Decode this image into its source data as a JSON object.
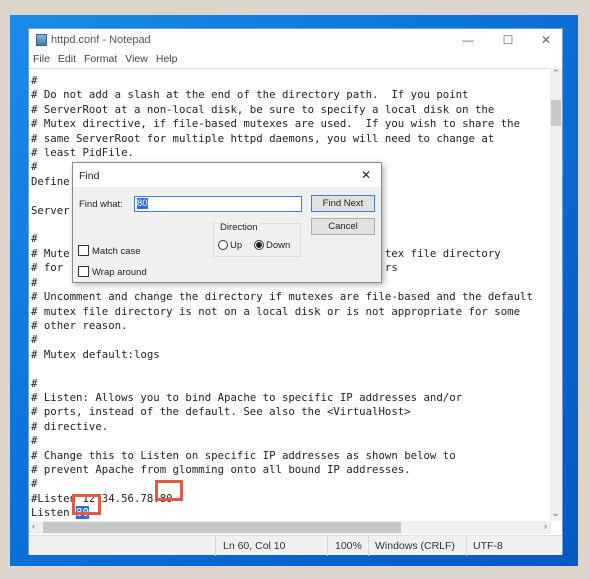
{
  "window": {
    "title": "httpd.conf - Notepad",
    "minimize": "—",
    "maximize": "☐",
    "close": "✕"
  },
  "menu": [
    "File",
    "Edit",
    "Format",
    "View",
    "Help"
  ],
  "editor": {
    "lines": [
      "#",
      "# Do not add a slash at the end of the directory path.  If you point",
      "# ServerRoot at a non-local disk, be sure to specify a local disk on the",
      "# Mutex directive, if file-based mutexes are used.  If you wish to share the",
      "# same ServerRoot for multiple httpd daemons, you will need to change at",
      "# least PidFile.",
      "#",
      "Define",
      "",
      "Server",
      "",
      "#",
      "# Mute                                                 tex file directory",
      "# for                                                  rs",
      "#",
      "# Uncomment and change the directory if mutexes are file-based and the default",
      "# mutex file directory is not on a local disk or is not appropriate for some",
      "# other reason.",
      "#",
      "# Mutex default:logs",
      "",
      "#",
      "# Listen: Allows you to bind Apache to specific IP addresses and/or",
      "# ports, instead of the default. See also the <VirtualHost>",
      "# directive.",
      "#",
      "# Change this to Listen on specific IP addresses as shown below to",
      "# prevent Apache from glomming onto all bound IP addresses.",
      "#",
      "#Listen 12.34.56.78:80"
    ],
    "last_line_prefix": "Listen ",
    "selected_text": "80"
  },
  "status": {
    "position": "Ln 60, Col 10",
    "zoom": "100%",
    "line_ending": "Windows (CRLF)",
    "encoding": "UTF-8"
  },
  "find_dialog": {
    "title": "Find",
    "close": "✕",
    "find_what_label": "Find what:",
    "find_what_value": "80",
    "find_next": "Find Next",
    "cancel": "Cancel",
    "direction_label": "Direction",
    "up": "Up",
    "down": "Down",
    "direction_selected": "Down",
    "match_case": "Match case",
    "match_case_checked": false,
    "wrap_around": "Wrap around",
    "wrap_around_checked": false
  },
  "colors": {
    "highlight_box": "#e05a45",
    "selection": "#2f6fd2",
    "desktop": "#0a6fd6"
  }
}
